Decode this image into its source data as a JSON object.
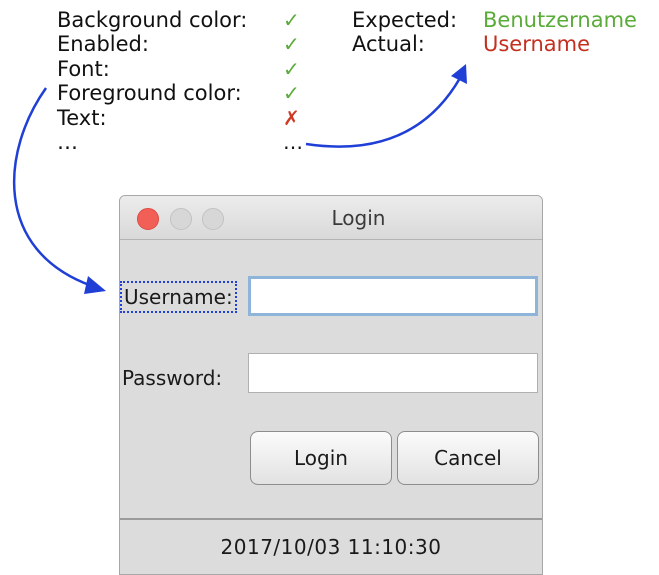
{
  "annotation": {
    "properties": [
      {
        "label": "Background color:",
        "mark": "✓",
        "status": "ok"
      },
      {
        "label": "Enabled:",
        "mark": "✓",
        "status": "ok"
      },
      {
        "label": "Font:",
        "mark": "✓",
        "status": "ok"
      },
      {
        "label": "Foreground color:",
        "mark": "✓",
        "status": "ok"
      },
      {
        "label": "Text:",
        "mark": "✗",
        "status": "bad"
      },
      {
        "label": "…",
        "mark": "…",
        "status": "none"
      }
    ],
    "comparison": {
      "expected_label": "Expected:",
      "expected_value": "Benutzername",
      "actual_label": "Actual:",
      "actual_value": "Username"
    },
    "colors": {
      "ok": "#5aab38",
      "bad": "#cf3a24",
      "arrow": "#1f3fd6"
    }
  },
  "window": {
    "title": "Login",
    "username_label": "Username:",
    "password_label": "Password:",
    "username_value": "",
    "password_value": "",
    "login_button": "Login",
    "cancel_button": "Cancel",
    "status_timestamp": "2017/10/03 11:10:30"
  }
}
